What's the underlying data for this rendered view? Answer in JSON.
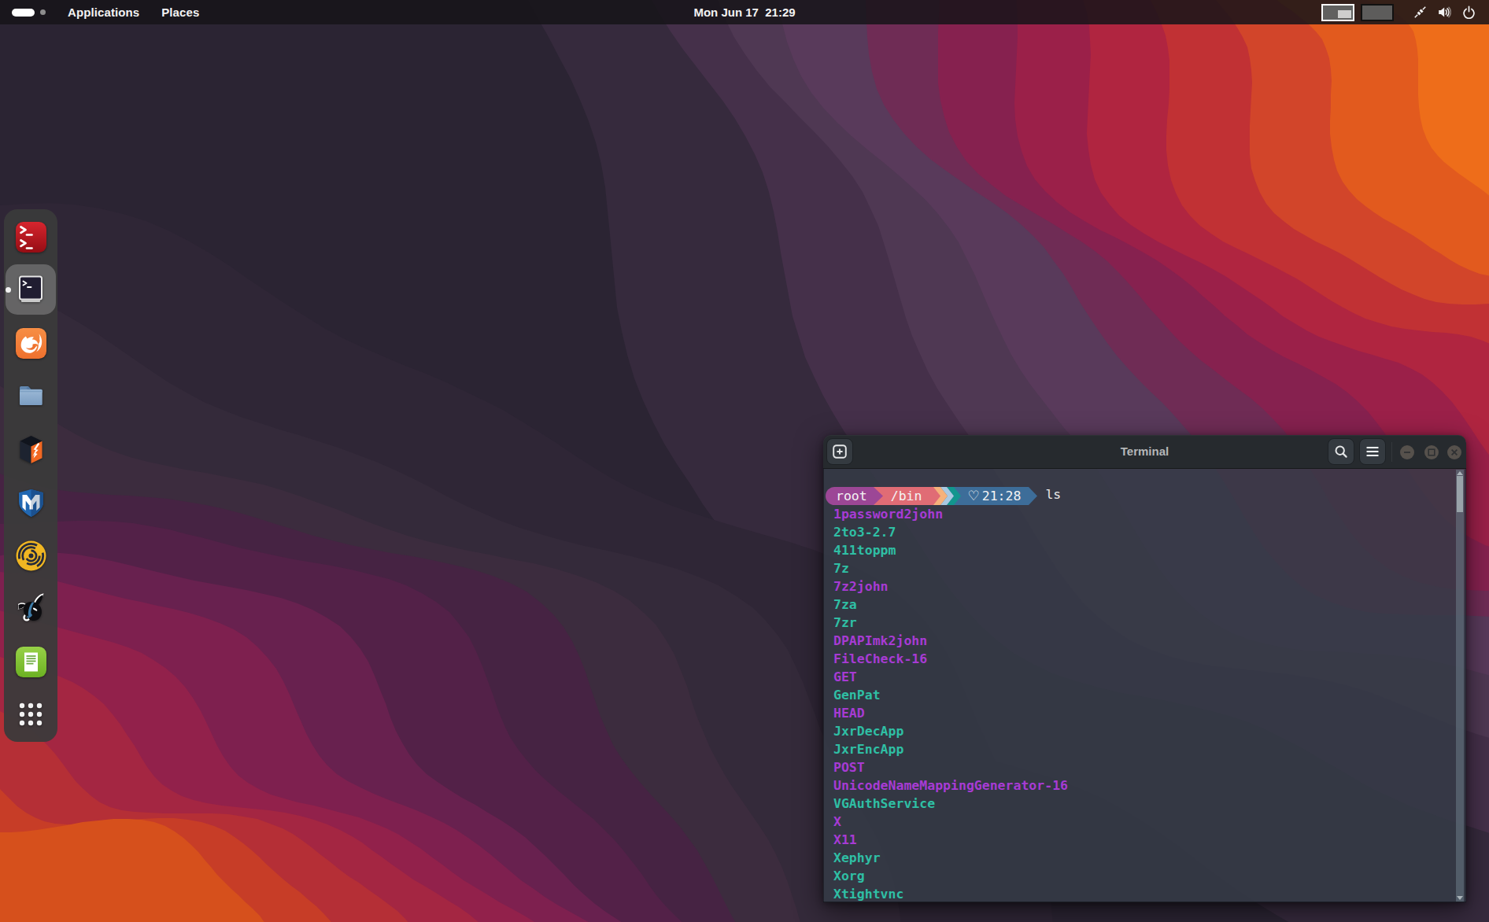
{
  "topbar": {
    "menus": [
      {
        "label": "Applications"
      },
      {
        "label": "Places"
      }
    ],
    "clock": "Mon Jun 17  21:29",
    "workspaces": {
      "count": 2,
      "active": 1
    },
    "tray_icons": [
      "network-icon",
      "volume-icon",
      "power-icon"
    ]
  },
  "dock": {
    "items": [
      {
        "name": "root-terminal",
        "active": false
      },
      {
        "name": "terminal",
        "active": true
      },
      {
        "name": "firefox",
        "active": false
      },
      {
        "name": "files",
        "active": false
      },
      {
        "name": "burpsuite",
        "active": false
      },
      {
        "name": "metasploit",
        "active": false
      },
      {
        "name": "faraday",
        "active": false
      },
      {
        "name": "beef",
        "active": false
      },
      {
        "name": "cherrytree",
        "active": false
      },
      {
        "name": "show-applications",
        "active": false
      }
    ]
  },
  "terminal": {
    "title": "Terminal",
    "prompt": {
      "user": "root",
      "dir": "/bin",
      "heart": "♡",
      "time": "21:28",
      "command": "ls"
    },
    "colors": {
      "segment_user_bg": "#9c4796",
      "segment_dir_bg": "#e06c75",
      "segment_time_bg": "#3d6d99",
      "chevron_orange": "#f5b27b",
      "chevron_blue": "#a9c9e2",
      "chevron_teal": "#12968e",
      "file_link": "#a73bd4",
      "file_exec": "#2fbfa4"
    },
    "files": [
      {
        "name": "1password2john",
        "type": "link"
      },
      {
        "name": "2to3-2.7",
        "type": "exec"
      },
      {
        "name": "411toppm",
        "type": "exec"
      },
      {
        "name": "7z",
        "type": "exec"
      },
      {
        "name": "7z2john",
        "type": "link"
      },
      {
        "name": "7za",
        "type": "exec"
      },
      {
        "name": "7zr",
        "type": "exec"
      },
      {
        "name": "DPAPImk2john",
        "type": "link"
      },
      {
        "name": "FileCheck-16",
        "type": "link"
      },
      {
        "name": "GET",
        "type": "link"
      },
      {
        "name": "GenPat",
        "type": "exec"
      },
      {
        "name": "HEAD",
        "type": "link"
      },
      {
        "name": "JxrDecApp",
        "type": "exec"
      },
      {
        "name": "JxrEncApp",
        "type": "exec"
      },
      {
        "name": "POST",
        "type": "link"
      },
      {
        "name": "UnicodeNameMappingGenerator-16",
        "type": "link"
      },
      {
        "name": "VGAuthService",
        "type": "exec"
      },
      {
        "name": "X",
        "type": "link"
      },
      {
        "name": "X11",
        "type": "link"
      },
      {
        "name": "Xephyr",
        "type": "exec"
      },
      {
        "name": "Xorg",
        "type": "exec"
      },
      {
        "name": "Xtightvnc",
        "type": "exec"
      }
    ]
  }
}
